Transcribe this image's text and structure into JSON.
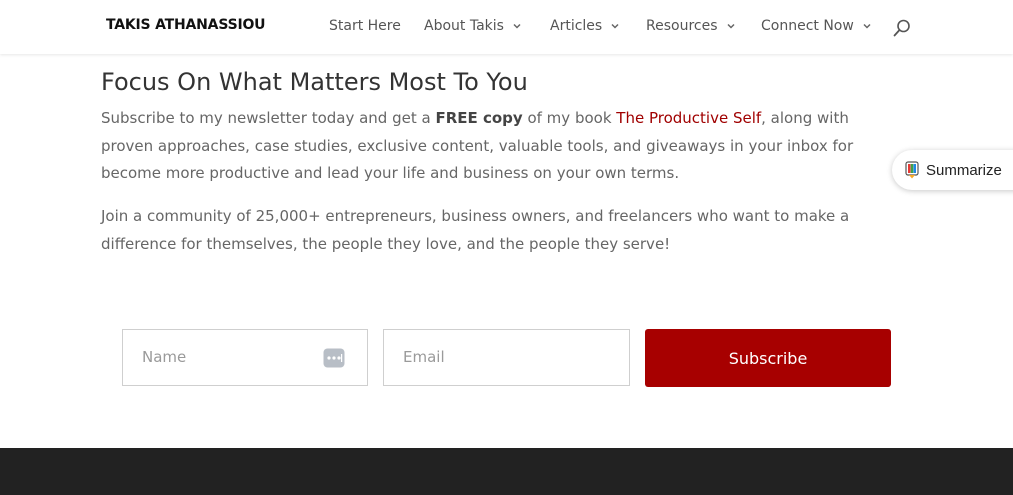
{
  "header": {
    "logo": "TAKIS ATHANASSIOU",
    "nav": [
      {
        "label": "Start Here",
        "has_dropdown": false
      },
      {
        "label": "About Takis",
        "has_dropdown": true
      },
      {
        "label": "Articles",
        "has_dropdown": true
      },
      {
        "label": "Resources",
        "has_dropdown": true
      },
      {
        "label": "Connect Now",
        "has_dropdown": true
      }
    ],
    "search_icon": "search-icon"
  },
  "main": {
    "headline": "Focus On What Matters Most To You",
    "para1": {
      "pre": "Subscribe to my newsletter today and get a ",
      "bold": "FREE copy",
      "mid": " of my book ",
      "book": "The Productive Self",
      "post": ", along with proven approaches, case studies, exclusive content, valuable tools, and giveaways in your inbox for become more productive and lead your life and business on your own terms."
    },
    "para2": "Join a community of 25,000+ entrepreneurs, business owners, and freelancers who want to make a difference for themselves, the people they love, and the people they serve!"
  },
  "summarize": {
    "label": "Summarize"
  },
  "form": {
    "name_placeholder": "Name",
    "email_placeholder": "Email",
    "subscribe_label": "Subscribe"
  },
  "colors": {
    "accent": "#a70000",
    "link": "#a00000",
    "footer": "#222222",
    "text": "#666666"
  }
}
